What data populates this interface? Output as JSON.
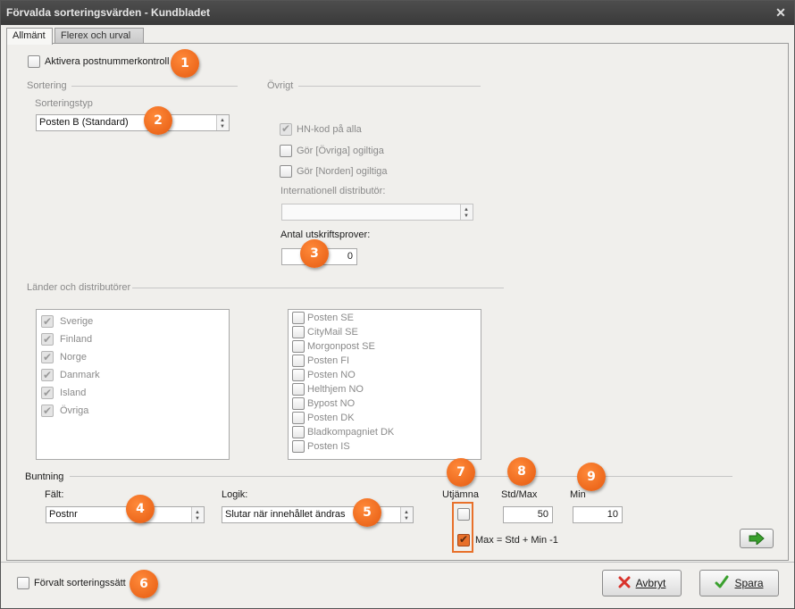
{
  "window": {
    "title": "Förvalda sorteringsvärden - Kundbladet",
    "close_glyph": "✕"
  },
  "tabs": [
    {
      "label": "Allmänt",
      "active": true
    },
    {
      "label": "Flerex och urval",
      "active": false
    }
  ],
  "postal_check": {
    "label": "Aktivera postnummerkontroll",
    "checked": false
  },
  "sorting": {
    "group_label": "Sortering",
    "type_label": "Sorteringstyp",
    "type_value": "Posten B (Standard)"
  },
  "other": {
    "group_label": "Övrigt",
    "hn_code": {
      "label": "HN-kod på alla",
      "checked": true
    },
    "invalid_other": {
      "label": "Gör [Övriga] ogiltiga",
      "checked": false
    },
    "invalid_north": {
      "label": "Gör [Norden] ogiltiga",
      "checked": false
    },
    "intl_distributor_label": "Internationell distributör:",
    "intl_distributor_value": "",
    "print_samples_label": "Antal utskriftsprover:",
    "print_samples_value": "0"
  },
  "countries_group_label": "Länder och distributörer",
  "countries": [
    {
      "label": "Sverige",
      "checked": true
    },
    {
      "label": "Finland",
      "checked": true
    },
    {
      "label": "Norge",
      "checked": true
    },
    {
      "label": "Danmark",
      "checked": true
    },
    {
      "label": "Island",
      "checked": true
    },
    {
      "label": "Övriga",
      "checked": true
    }
  ],
  "distributors": [
    {
      "label": "Posten SE",
      "checked": false
    },
    {
      "label": "CityMail SE",
      "checked": false
    },
    {
      "label": "Morgonpost SE",
      "checked": false
    },
    {
      "label": "Posten FI",
      "checked": false
    },
    {
      "label": "Posten NO",
      "checked": false
    },
    {
      "label": "Helthjem NO",
      "checked": false
    },
    {
      "label": "Bypost NO",
      "checked": false
    },
    {
      "label": "Posten DK",
      "checked": false
    },
    {
      "label": "Bladkompagniet DK",
      "checked": false
    },
    {
      "label": "Posten IS",
      "checked": false
    }
  ],
  "bundling": {
    "group_label": "Buntning",
    "field_label": "Fält:",
    "field_value": "Postnr",
    "logic_label": "Logik:",
    "logic_value": "Slutar när innehållet ändras",
    "equalize_label": "Utjämna",
    "equalize_checked": false,
    "stdmax_label": "Std/Max",
    "stdmax_value": "50",
    "min_label": "Min",
    "min_value": "10",
    "max_formula_label": "Max = Std + Min -1",
    "max_formula_checked": true
  },
  "default_sort": {
    "label": "Förvalt sorteringssätt",
    "checked": false
  },
  "buttons": {
    "cancel": "Avbryt",
    "save": "Spara"
  },
  "badges": [
    "1",
    "2",
    "3",
    "4",
    "5",
    "6",
    "7",
    "8",
    "9"
  ],
  "colors": {
    "badge": "#e8702a",
    "titlebar": "#3f3f3f",
    "cancel_icon": "#d9322b",
    "save_icon": "#3aa02e"
  }
}
